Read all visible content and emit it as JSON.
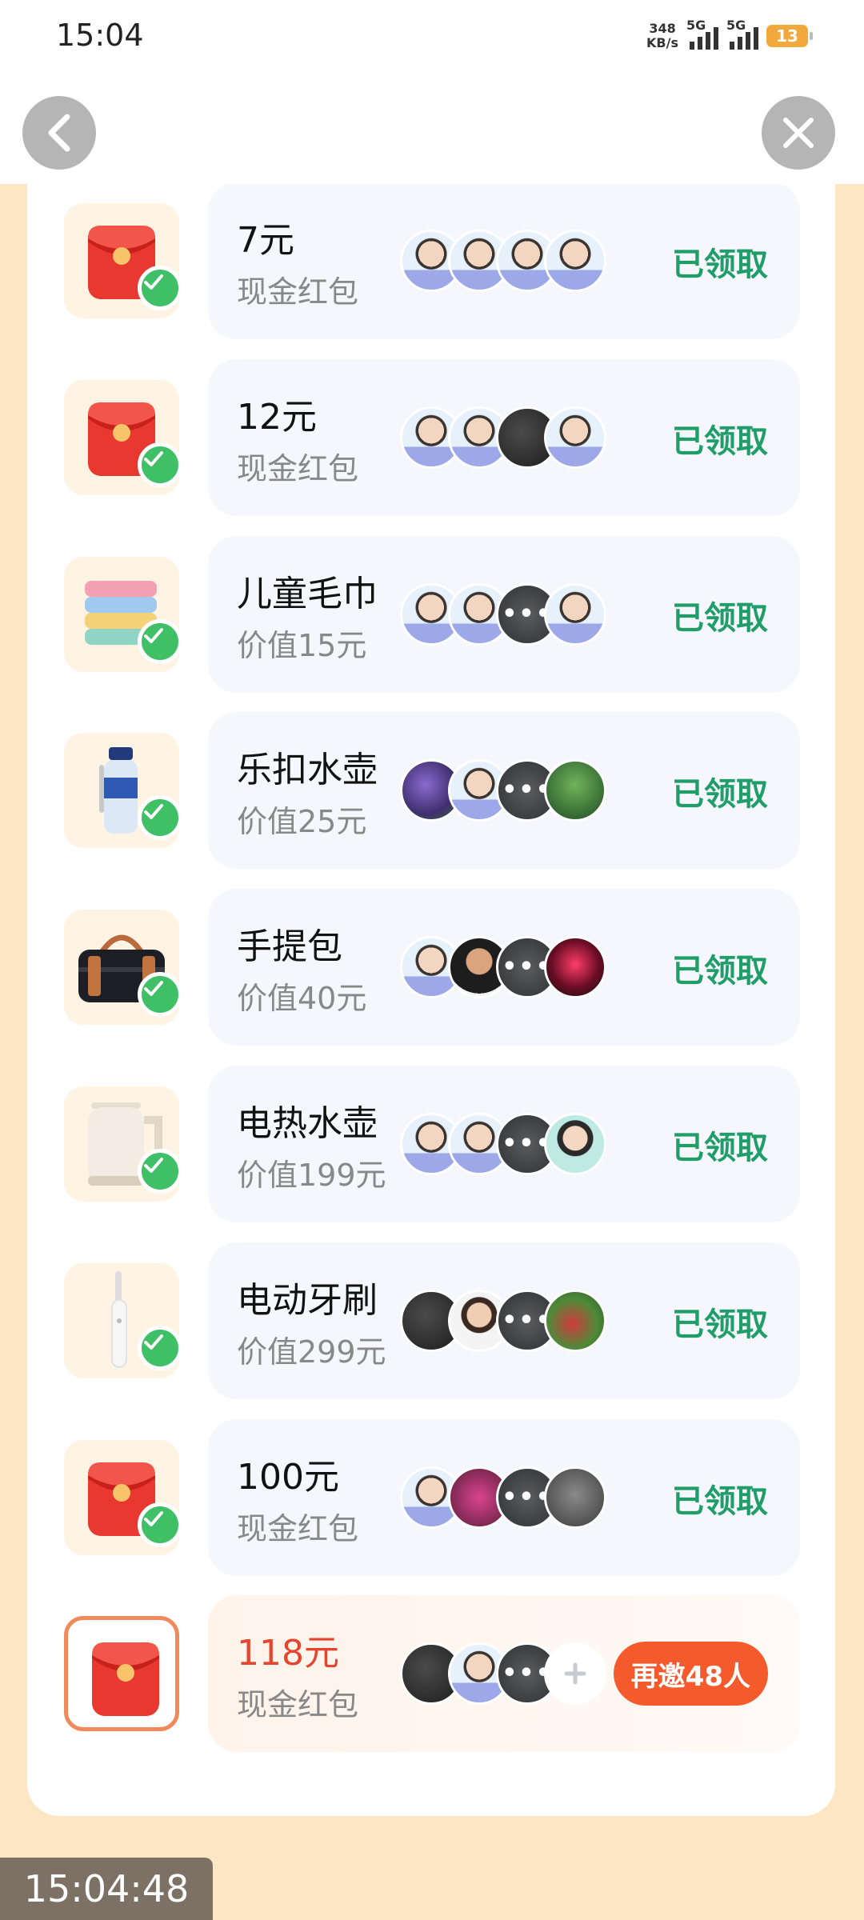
{
  "status_bar": {
    "time": "15:04",
    "net_speed_value": "348",
    "net_speed_unit": "KB/s",
    "signal_1": "5G",
    "signal_2": "5G",
    "battery": "13"
  },
  "nav": {
    "back_icon": "chevron-left-icon",
    "close_icon": "close-icon"
  },
  "rewards": [
    {
      "title": "7元",
      "subtitle": "现金红包",
      "icon": "red-envelope",
      "claimed": true,
      "status": "已领取",
      "avatars": [
        "default",
        "default",
        "default",
        "default"
      ]
    },
    {
      "title": "12元",
      "subtitle": "现金红包",
      "icon": "red-envelope",
      "claimed": true,
      "status": "已领取",
      "avatars": [
        "default",
        "default",
        "photo-dark",
        "default"
      ]
    },
    {
      "title": "儿童毛巾",
      "subtitle": "价值15元",
      "icon": "towels",
      "claimed": true,
      "status": "已领取",
      "avatars": [
        "default",
        "default",
        "more",
        "default"
      ]
    },
    {
      "title": "乐扣水壶",
      "subtitle": "价值25元",
      "icon": "water-bottle",
      "claimed": true,
      "status": "已领取",
      "avatars": [
        "photo-purple",
        "default",
        "more",
        "photo-green"
      ]
    },
    {
      "title": "手提包",
      "subtitle": "价值40元",
      "icon": "handbag",
      "claimed": true,
      "status": "已领取",
      "avatars": [
        "default",
        "photo-man",
        "more",
        "photo-red"
      ]
    },
    {
      "title": "电热水壶",
      "subtitle": "价值199元",
      "icon": "electric-kettle",
      "claimed": true,
      "status": "已领取",
      "avatars": [
        "default",
        "default",
        "more",
        "photo-woman"
      ]
    },
    {
      "title": "电动牙刷",
      "subtitle": "价值299元",
      "icon": "electric-toothbrush",
      "claimed": true,
      "status": "已领取",
      "avatars": [
        "photo-dark",
        "photo-woman2",
        "more",
        "photo-flowers"
      ]
    },
    {
      "title": "100元",
      "subtitle": "现金红包",
      "icon": "red-envelope",
      "claimed": true,
      "status": "已领取",
      "avatars": [
        "default",
        "photo-pink",
        "more",
        "photo-gray"
      ]
    },
    {
      "title": "118元",
      "subtitle": "现金红包",
      "icon": "red-envelope",
      "claimed": false,
      "status": "再邀48人",
      "avatars": [
        "photo-dark",
        "default",
        "more",
        "plus"
      ]
    }
  ],
  "overlay_timestamp": "15:04:48"
}
